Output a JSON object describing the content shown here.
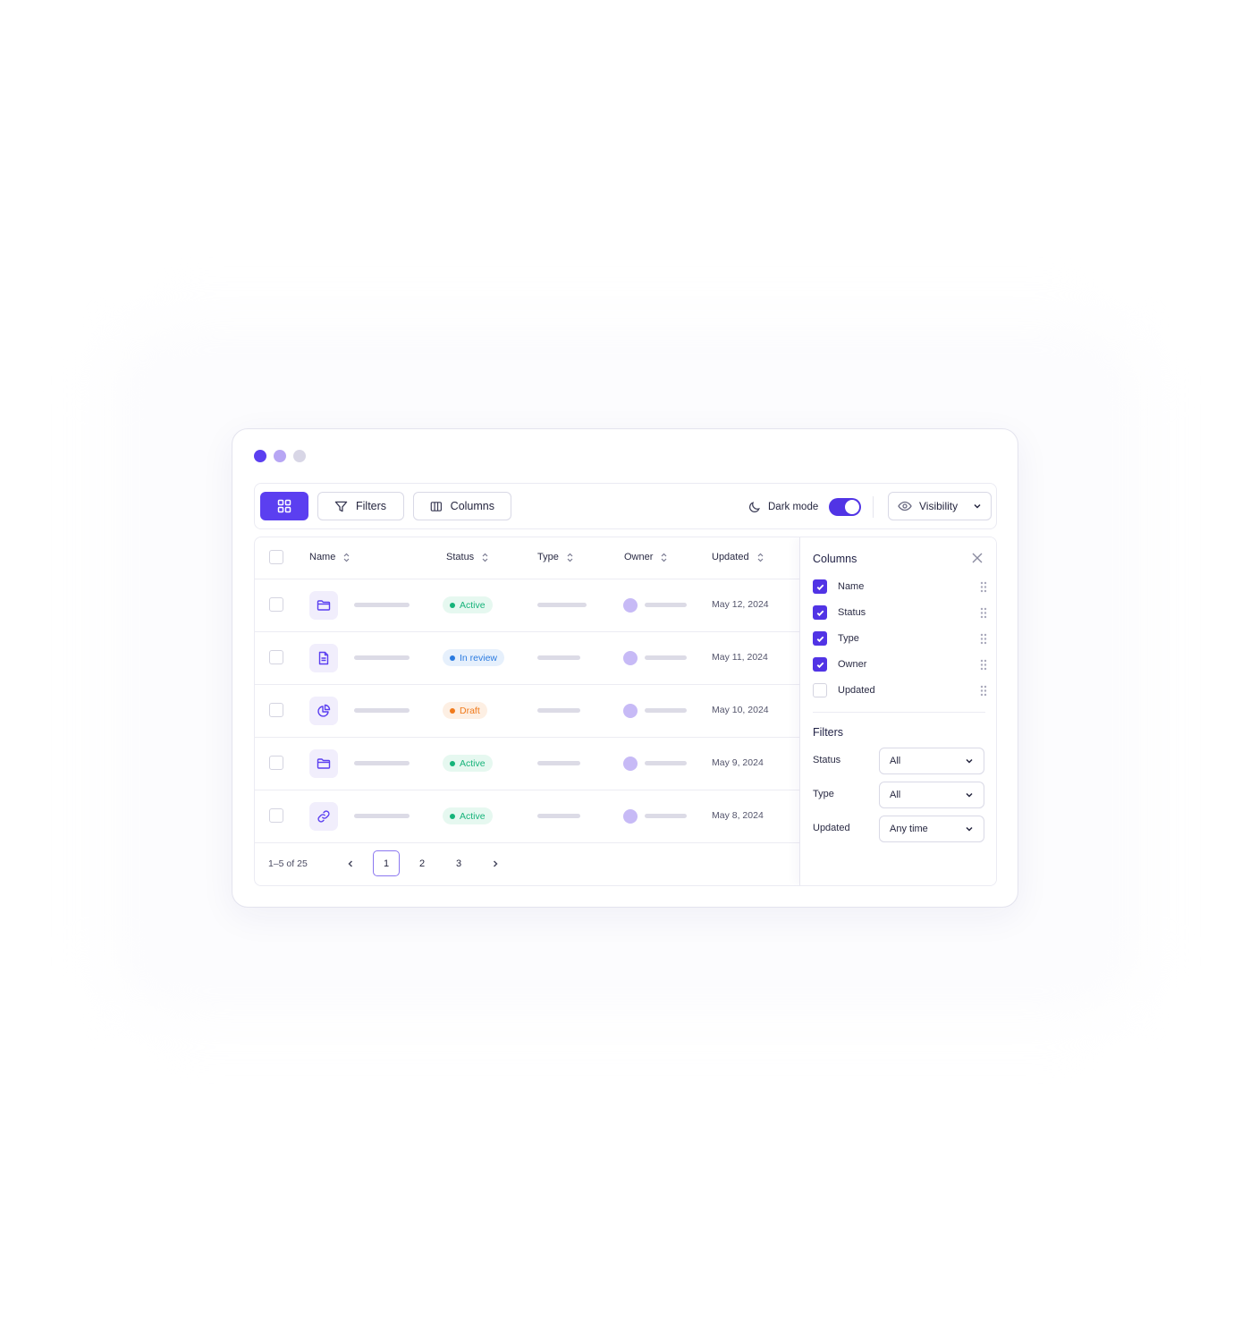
{
  "window": {
    "dots": [
      "#5b3ff0",
      "#b7a6f4",
      "#d8d6e6"
    ]
  },
  "toolbar": {
    "grid_icon": "grid-icon",
    "filters_label": "Filters",
    "columns_label": "Columns",
    "dark_mode_label": "Dark mode",
    "dark_mode_on": true,
    "visibility_label": "Visibility"
  },
  "table": {
    "headers": [
      "Name",
      "Status",
      "Type",
      "Owner",
      "Updated"
    ],
    "rows": [
      {
        "icon": "folder-icon",
        "status": "Active",
        "status_kind": "active",
        "updated": "May 12, 2024"
      },
      {
        "icon": "document-icon",
        "status": "In review",
        "status_kind": "review",
        "updated": "May 11, 2024"
      },
      {
        "icon": "pie-chart-icon",
        "status": "Draft",
        "status_kind": "draft",
        "updated": "May 10, 2024"
      },
      {
        "icon": "folder-icon",
        "status": "Active",
        "status_kind": "active",
        "updated": "May 9, 2024"
      },
      {
        "icon": "link-icon",
        "status": "Active",
        "status_kind": "active",
        "updated": "May 8, 2024"
      }
    ]
  },
  "pagination": {
    "info": "1–5 of 25",
    "pages": [
      "1",
      "2",
      "3"
    ],
    "current": "1"
  },
  "panel": {
    "columns_title": "Columns",
    "columns": [
      {
        "label": "Name",
        "checked": true
      },
      {
        "label": "Status",
        "checked": true
      },
      {
        "label": "Type",
        "checked": true
      },
      {
        "label": "Owner",
        "checked": true
      },
      {
        "label": "Updated",
        "checked": false
      }
    ],
    "filters_title": "Filters",
    "filters": [
      {
        "label": "Status",
        "value": "All"
      },
      {
        "label": "Type",
        "value": "All"
      },
      {
        "label": "Updated",
        "value": "Any time"
      }
    ]
  },
  "colors": {
    "accent": "#5134e5",
    "active": "#16b37a",
    "review": "#2b7be0",
    "draft": "#f07a1c"
  }
}
